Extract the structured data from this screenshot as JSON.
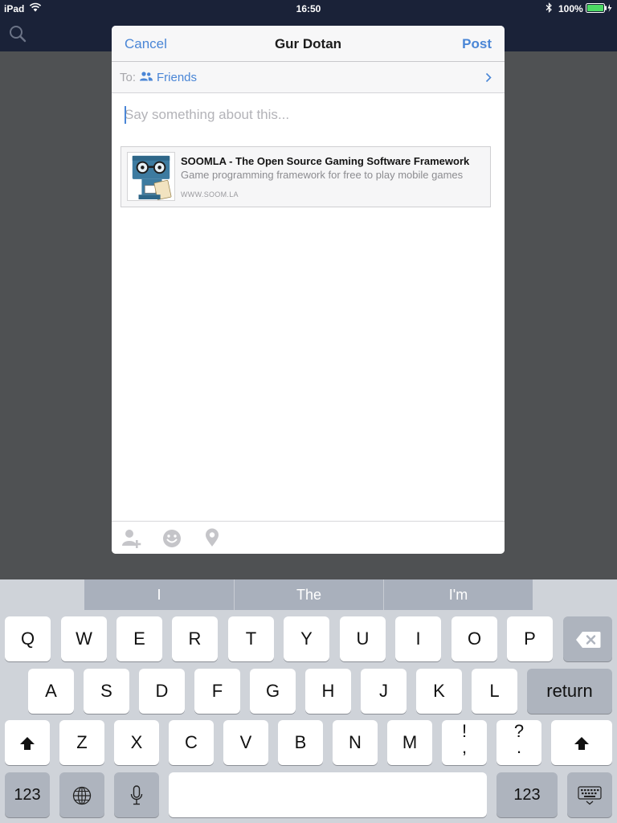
{
  "status_bar": {
    "device": "iPad",
    "time": "16:50",
    "battery": "100%"
  },
  "composer": {
    "cancel_label": "Cancel",
    "title": "Gur Dotan",
    "post_label": "Post",
    "audience": {
      "prefix": "To:",
      "value": "Friends"
    },
    "status_placeholder": "Say something about this...",
    "link_preview": {
      "title": "SOOMLA - The Open Source Gaming Software Framework",
      "description": "Game programming framework for free to play mobile games",
      "domain": "WWW.SOOM.LA"
    },
    "toolbar": [
      "tag-people-icon",
      "feeling-icon",
      "location-icon"
    ]
  },
  "keyboard": {
    "suggestions": [
      "I",
      "The",
      "I'm"
    ],
    "row1": [
      "Q",
      "W",
      "E",
      "R",
      "T",
      "Y",
      "U",
      "I",
      "O",
      "P"
    ],
    "row2": [
      "A",
      "S",
      "D",
      "F",
      "G",
      "H",
      "J",
      "K",
      "L"
    ],
    "return_label": "return",
    "row3": [
      "Z",
      "X",
      "C",
      "V",
      "B",
      "N",
      "M"
    ],
    "punct1": {
      "top": "!",
      "bottom": ","
    },
    "punct2": {
      "top": "?",
      "bottom": "."
    },
    "numbers_label": "123"
  },
  "colors": {
    "accent": "#4a86d6",
    "header_bg": "#1a2238",
    "keyboard_bg": "#cfd3d9"
  }
}
